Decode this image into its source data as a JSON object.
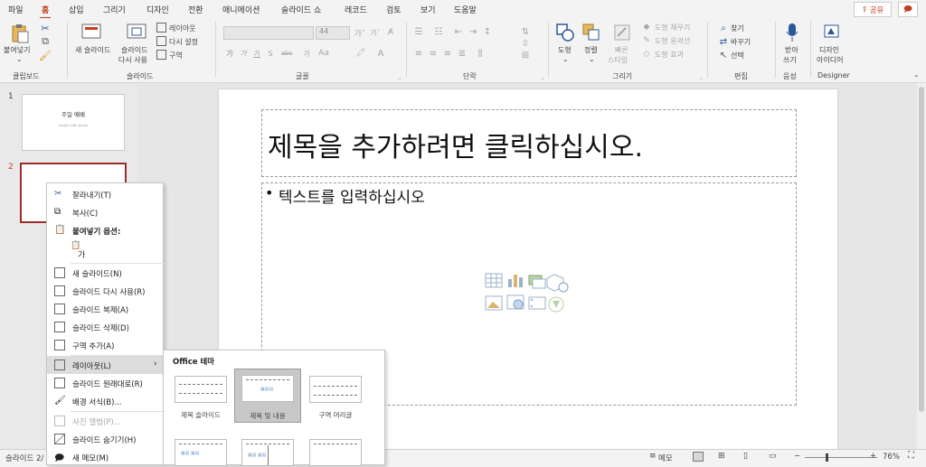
{
  "tabs": [
    "파일",
    "홈",
    "삽입",
    "그리기",
    "디자인",
    "전환",
    "애니메이션",
    "슬라이드 쇼",
    "레코드",
    "검토",
    "보기",
    "도움말"
  ],
  "active_tab": "홈",
  "share_label": "공유",
  "ribbon": {
    "clipboard": {
      "paste": "붙여넣기",
      "group": "클립보드"
    },
    "slides": {
      "new_slide": "새 슬라이드",
      "reuse_1": "슬라이드",
      "reuse_2": "다시 사용",
      "layout": "레이아웃",
      "reset": "다시 설정",
      "section": "구역",
      "group": "슬라이드"
    },
    "font": {
      "size": "44",
      "group": "글꼴",
      "buttons": [
        "가",
        "가",
        "가",
        "S",
        "abc",
        "가"
      ]
    },
    "paragraph": {
      "group": "단락"
    },
    "drawing": {
      "shapes": "도형",
      "arrange": "정렬",
      "quick_1": "빠른",
      "quick_2": "스타일",
      "fill": "도형 채우기",
      "outline": "도형 윤곽선",
      "effects": "도형 효과",
      "group": "그리기"
    },
    "editing": {
      "find": "찾기",
      "replace": "바꾸기",
      "select": "선택",
      "group": "편집"
    },
    "voice": {
      "dictate_1": "받아",
      "dictate_2": "쓰기",
      "group": "음성"
    },
    "designer": {
      "ideas_1": "디자인",
      "ideas_2": "아이디어",
      "group": "Designer"
    }
  },
  "slides": [
    {
      "num": "1",
      "title": "주일 예배",
      "subtitle": "Insight with words"
    },
    {
      "num": "2"
    }
  ],
  "slide": {
    "title_placeholder": "제목을 추가하려면 클릭하십시오.",
    "body_placeholder": "텍스트를 입력하십시오"
  },
  "context_menu": {
    "cut": "잘라내기(T)",
    "copy": "복사(C)",
    "paste_options": "붙여넣기 옵션:",
    "paste_keep": "가",
    "new_slide": "새 슬라이드(N)",
    "reuse": "슬라이드 다시 사용(R)",
    "duplicate": "슬라이드 복제(A)",
    "delete": "슬라이드 삭제(D)",
    "add_section": "구역 추가(A)",
    "layout": "레이아웃(L)",
    "reset": "슬라이드 원래대로(R)",
    "format_bg": "배경 서식(B)...",
    "photo_album": "사진 앨범(P)...",
    "hide": "슬라이드 숨기기(H)",
    "new_comment": "새 메모(M)"
  },
  "layout_submenu": {
    "theme": "Office 테마",
    "layouts": [
      "제목 슬라이드",
      "제목 및 내용",
      "구역 머리글"
    ]
  },
  "status": {
    "slide_info": "슬라이드 2/",
    "notes": "메모",
    "zoom": "76%"
  },
  "colors": {
    "accent": "#c43e1c",
    "selected_thumb": "#9d2a2a"
  }
}
